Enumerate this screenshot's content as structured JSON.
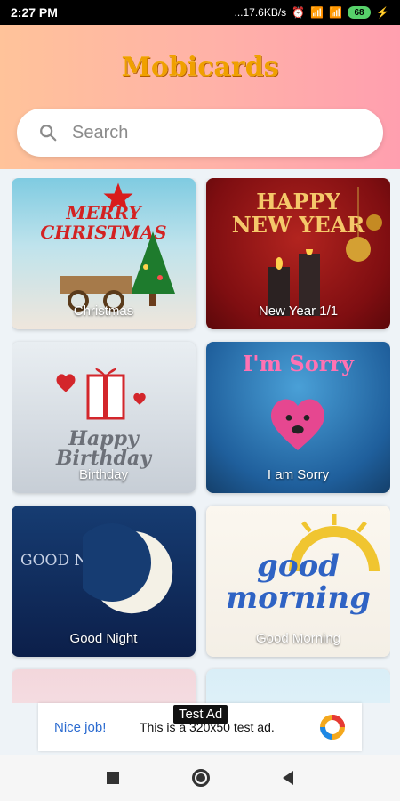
{
  "status": {
    "time": "2:27 PM",
    "network": "...17.6KB/s",
    "battery": "68"
  },
  "app": {
    "logo": "Mobicards"
  },
  "search": {
    "placeholder": "Search"
  },
  "cards": [
    {
      "label": "Christmas",
      "art": "MERRY\nCHRISTMAS"
    },
    {
      "label": "New Year 1/1",
      "art": "HAPPY\nNEW YEAR"
    },
    {
      "label": "Birthday",
      "art": "Happy\nBirthday"
    },
    {
      "label": "I am Sorry",
      "art": "I'm Sorry"
    },
    {
      "label": "Good Night",
      "art": "GOOD NIGHT"
    },
    {
      "label": "Good Morning",
      "art": "good\nmorning"
    },
    {
      "label": "",
      "art": ""
    },
    {
      "label": "",
      "art": ""
    }
  ],
  "ad": {
    "badge": "Test Ad",
    "nice": "Nice job!",
    "text": "This is a 320x50 test ad."
  },
  "nav": {
    "icons": [
      "recent-apps-icon",
      "home-icon",
      "back-icon"
    ]
  },
  "colors": {
    "logo": "#f0a000",
    "ad_link": "#2b6bd0"
  }
}
